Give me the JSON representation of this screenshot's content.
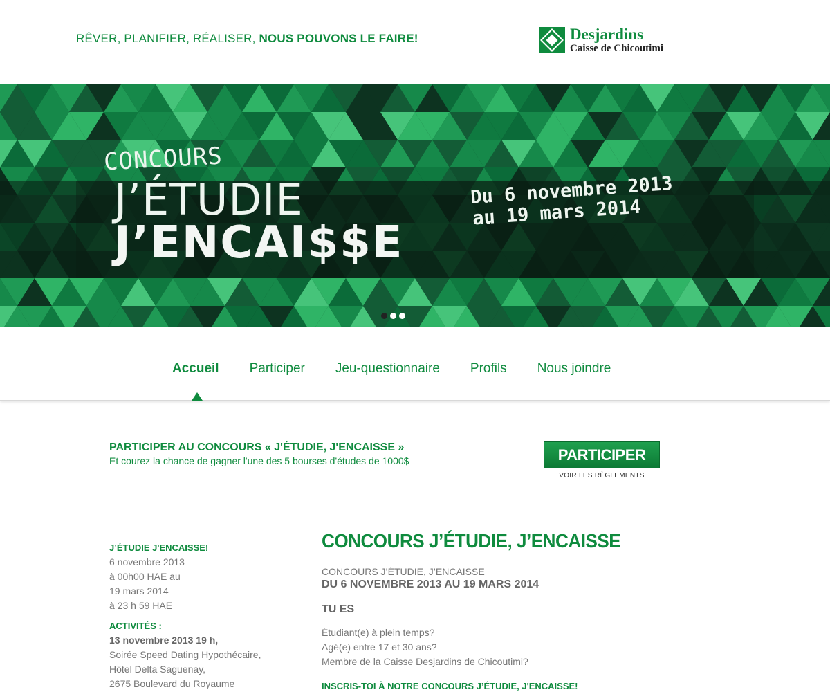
{
  "header": {
    "tagline_regular": "RÊVER, PLANIFIER, RÉALISER, ",
    "tagline_bold": "NOUS POUVONS LE FAIRE!",
    "logo_name": "Desjardins",
    "logo_sub": "Caisse de Chicoutimi"
  },
  "hero": {
    "line1": "CONCOURS",
    "line2": "J’ÉTUDIE",
    "line3": "J’ENCAI$$E",
    "date_line1": "Du 6 novembre 2013",
    "date_line2": "au 19 mars 2014",
    "slides": 3,
    "active_slide": 1
  },
  "nav": {
    "items": [
      {
        "label": "Accueil",
        "active": true
      },
      {
        "label": "Participer",
        "active": false
      },
      {
        "label": "Jeu-questionnaire",
        "active": false
      },
      {
        "label": "Profils",
        "active": false
      },
      {
        "label": "Nous joindre",
        "active": false
      }
    ]
  },
  "cta": {
    "title": "PARTICIPER AU CONCOURS « J'ÉTUDIE, J'ENCAISSE »",
    "subtitle": "Et courez la chance de gagner l'une des 5 bourses d'études de 1000$",
    "button_label": "PARTICIPER",
    "rules_label": "VOIR LES RÈGLEMENTS"
  },
  "sidebar": {
    "section1_title": "J’ÉTUDIE J'ENCAISSE!",
    "section1_lines": [
      "6 novembre 2013",
      "à 00h00 HAE au",
      "19 mars 2014",
      "à 23 h 59 HAE"
    ],
    "section2_title": "ACTIVITÉS :",
    "section2_date": "13 novembre 2013 19 h,",
    "section2_lines": [
      "Soirée Speed Dating Hypothécaire,",
      "Hôtel Delta Saguenay,",
      "2675 Boulevard du Royaume"
    ]
  },
  "main": {
    "title": "CONCOURS J’ÉTUDIE, J’ENCAISSE",
    "subtitle": "CONCOURS J’ÉTUDIE, J’ENCAISSE",
    "dates": "DU 6 NOVEMBRE 2013 AU 19 MARS 2014",
    "tues": "TU ES",
    "criteria": [
      "Étudiant(e) à plein temps?",
      "Agé(e) entre 17 et 30 ans?",
      "Membre de la Caisse Desjardins de Chicoutimi?"
    ],
    "signup": "INSCRIS-TOI À NOTRE CONCOURS J’ÉTUDIE, J'ENCAISSE!"
  },
  "colors": {
    "brand_green": "#0f8b3e",
    "hero_dark": "#0e3a24",
    "text_gray": "#777777"
  }
}
